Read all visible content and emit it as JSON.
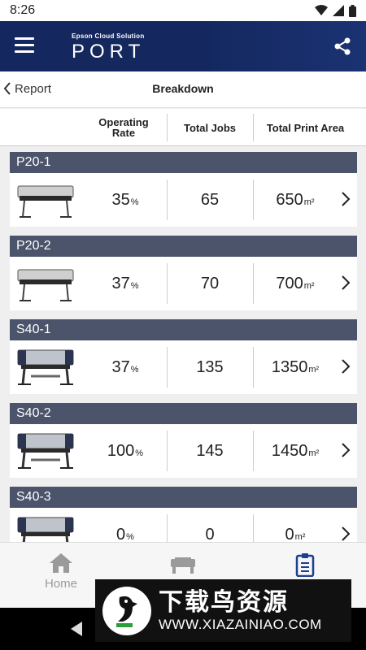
{
  "status_bar": {
    "time": "8:26"
  },
  "app_bar": {
    "brand_small": "Epson Cloud Solution",
    "brand_large": "PORT"
  },
  "nav": {
    "back_label": "Report",
    "title": "Breakdown"
  },
  "columns": {
    "rate": "Operating Rate",
    "jobs": "Total Jobs",
    "area": "Total Print Area"
  },
  "printers": [
    {
      "name": "P20-1",
      "rate": "35",
      "rate_unit": "%",
      "jobs": "65",
      "area": "650",
      "area_unit": "m²"
    },
    {
      "name": "P20-2",
      "rate": "37",
      "rate_unit": "%",
      "jobs": "70",
      "area": "700",
      "area_unit": "m²"
    },
    {
      "name": "S40-1",
      "rate": "37",
      "rate_unit": "%",
      "jobs": "135",
      "area": "1350",
      "area_unit": "m²"
    },
    {
      "name": "S40-2",
      "rate": "100",
      "rate_unit": "%",
      "jobs": "145",
      "area": "1450",
      "area_unit": "m²"
    },
    {
      "name": "S40-3",
      "rate": "0",
      "rate_unit": "%",
      "jobs": "0",
      "area": "0",
      "area_unit": "m²"
    }
  ],
  "bottom_nav": {
    "home": "Home"
  },
  "watermark": {
    "cn": "下载鸟资源",
    "url": "WWW.XIAZAINIAO.COM"
  },
  "colors": {
    "app_bar": "#14275e",
    "card_header": "#4b546a",
    "active_tab": "#1c3f91"
  }
}
